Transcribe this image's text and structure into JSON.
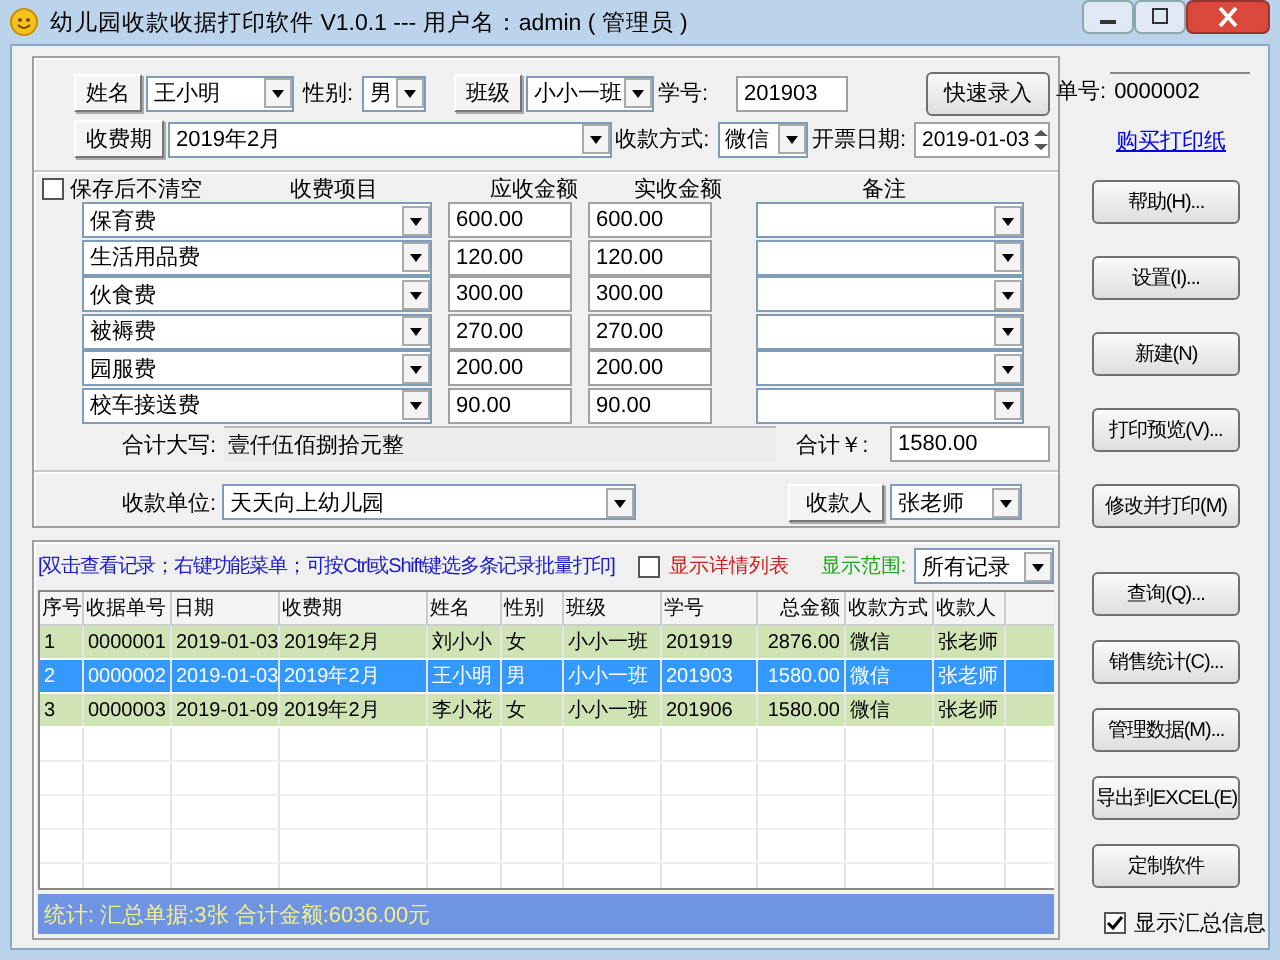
{
  "window": {
    "title": "幼儿园收款收据打印软件 V1.0.1 --- 用户名：admin ( 管理员 )"
  },
  "form": {
    "name_button": "姓名",
    "name": "王小明",
    "gender_label": "性别:",
    "gender": "男",
    "class_button": "班级",
    "class": "小小一班",
    "student_no_label": "学号:",
    "student_no": "201903",
    "quick_button": "快速录入",
    "period_button": "收费期",
    "period": "2019年2月",
    "pay_method_label": "收款方式:",
    "pay_method": "微信",
    "date_label": "开票日期:",
    "date": "2019-01-03"
  },
  "keep_checkbox": {
    "label": "保存后不清空",
    "checked": false
  },
  "item_columns": [
    "收费项目",
    "应收金额",
    "实收金额",
    "备注"
  ],
  "items": [
    {
      "name": "保育费",
      "due": "600.00",
      "paid": "600.00"
    },
    {
      "name": "生活用品费",
      "due": "120.00",
      "paid": "120.00"
    },
    {
      "name": "伙食费",
      "due": "300.00",
      "paid": "300.00"
    },
    {
      "name": "被褥费",
      "due": "270.00",
      "paid": "270.00"
    },
    {
      "name": "园服费",
      "due": "200.00",
      "paid": "200.00"
    },
    {
      "name": "校车接送费",
      "due": "90.00",
      "paid": "90.00"
    }
  ],
  "totals": {
    "words_label": "合计大写:",
    "words": "壹仟伍佰捌拾元整",
    "total_label": "合计￥:",
    "total": "1580.00"
  },
  "payee": {
    "label": "收款单位:",
    "value": "天天向上幼儿园",
    "collector_button": "收款人",
    "collector": "张老师"
  },
  "receipt": {
    "label": "单号:",
    "value": "0000002",
    "link": "购买打印纸"
  },
  "top_buttons": [
    "帮助(H)...",
    "设置(I)...",
    "新建(N)",
    "打印预览(V)...",
    "修改并打印(M)"
  ],
  "records": {
    "hint": "[双击查看记录；右键功能菜单；可按Ctrl或Shift键选多条记录批量打印]",
    "detail_checkbox": {
      "label": "显示详情列表",
      "checked": false
    },
    "range_label": "显示范围:",
    "range": "所有记录",
    "columns": [
      "序号",
      "收据单号",
      "日期",
      "收费期",
      "姓名",
      "性别",
      "班级",
      "学号",
      "总金额",
      "收款方式",
      "收款人"
    ],
    "rows": [
      {
        "cells": [
          "1",
          "0000001",
          "2019-01-03",
          "2019年2月",
          "刘小小",
          "女",
          "小小一班",
          "201919",
          "2876.00",
          "微信",
          "张老师"
        ],
        "selected": false
      },
      {
        "cells": [
          "2",
          "0000002",
          "2019-01-03",
          "2019年2月",
          "王小明",
          "男",
          "小小一班",
          "201903",
          "1580.00",
          "微信",
          "张老师"
        ],
        "selected": true
      },
      {
        "cells": [
          "3",
          "0000003",
          "2019-01-09",
          "2019年2月",
          "李小花",
          "女",
          "小小一班",
          "201906",
          "1580.00",
          "微信",
          "张老师"
        ],
        "selected": false
      }
    ],
    "summary": "统计: 汇总单据:3张 合计金额:6036.00元"
  },
  "bottom_buttons": [
    "查询(Q)...",
    "销售统计(C)...",
    "管理数据(M)...",
    "导出到EXCEL(E)",
    "定制软件"
  ],
  "summary_checkbox": {
    "label": "显示汇总信息",
    "checked": true
  }
}
